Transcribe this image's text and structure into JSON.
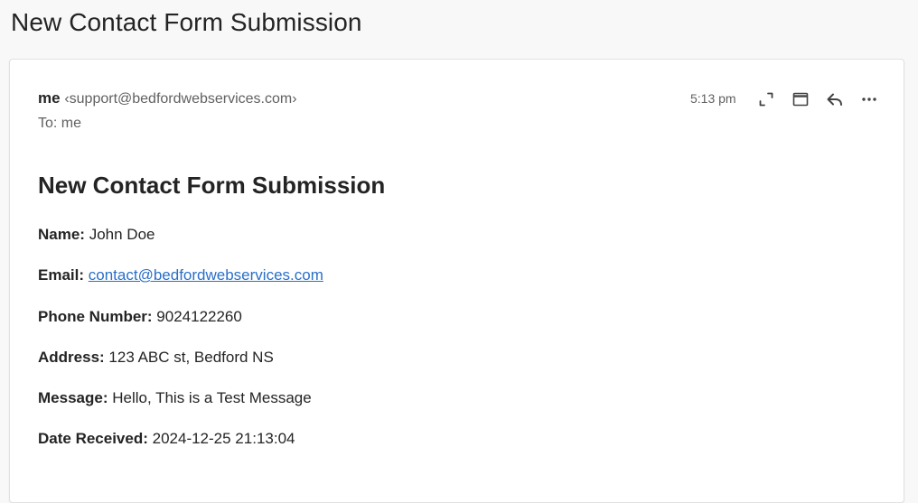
{
  "subject": "New Contact Form Submission",
  "message": {
    "from_name": "me",
    "from_email": "‹support@bedfordwebservices.com›",
    "to_label": "To:",
    "to_value": "me",
    "time": "5:13 pm",
    "actions": [
      {
        "name": "expand",
        "icon": "expand-icon"
      },
      {
        "name": "popout",
        "icon": "window-icon"
      },
      {
        "name": "reply",
        "icon": "reply-icon"
      },
      {
        "name": "more",
        "icon": "more-icon"
      }
    ],
    "body": {
      "title": "New Contact Form Submission",
      "fields": [
        {
          "label": "Name:",
          "value": "John Doe"
        },
        {
          "label": "Email:",
          "value": "contact@bedfordwebservices.com"
        },
        {
          "label": "Phone Number:",
          "value": "9024122260"
        },
        {
          "label": "Address:",
          "value": "123 ABC st, Bedford NS"
        },
        {
          "label": "Message:",
          "value": "Hello, This is a Test Message"
        },
        {
          "label": "Date Received:",
          "value": "2024-12-25 21:13:04"
        }
      ]
    }
  },
  "colors": {
    "link": "#2a6fc9",
    "text": "#242424",
    "muted": "#616161"
  }
}
